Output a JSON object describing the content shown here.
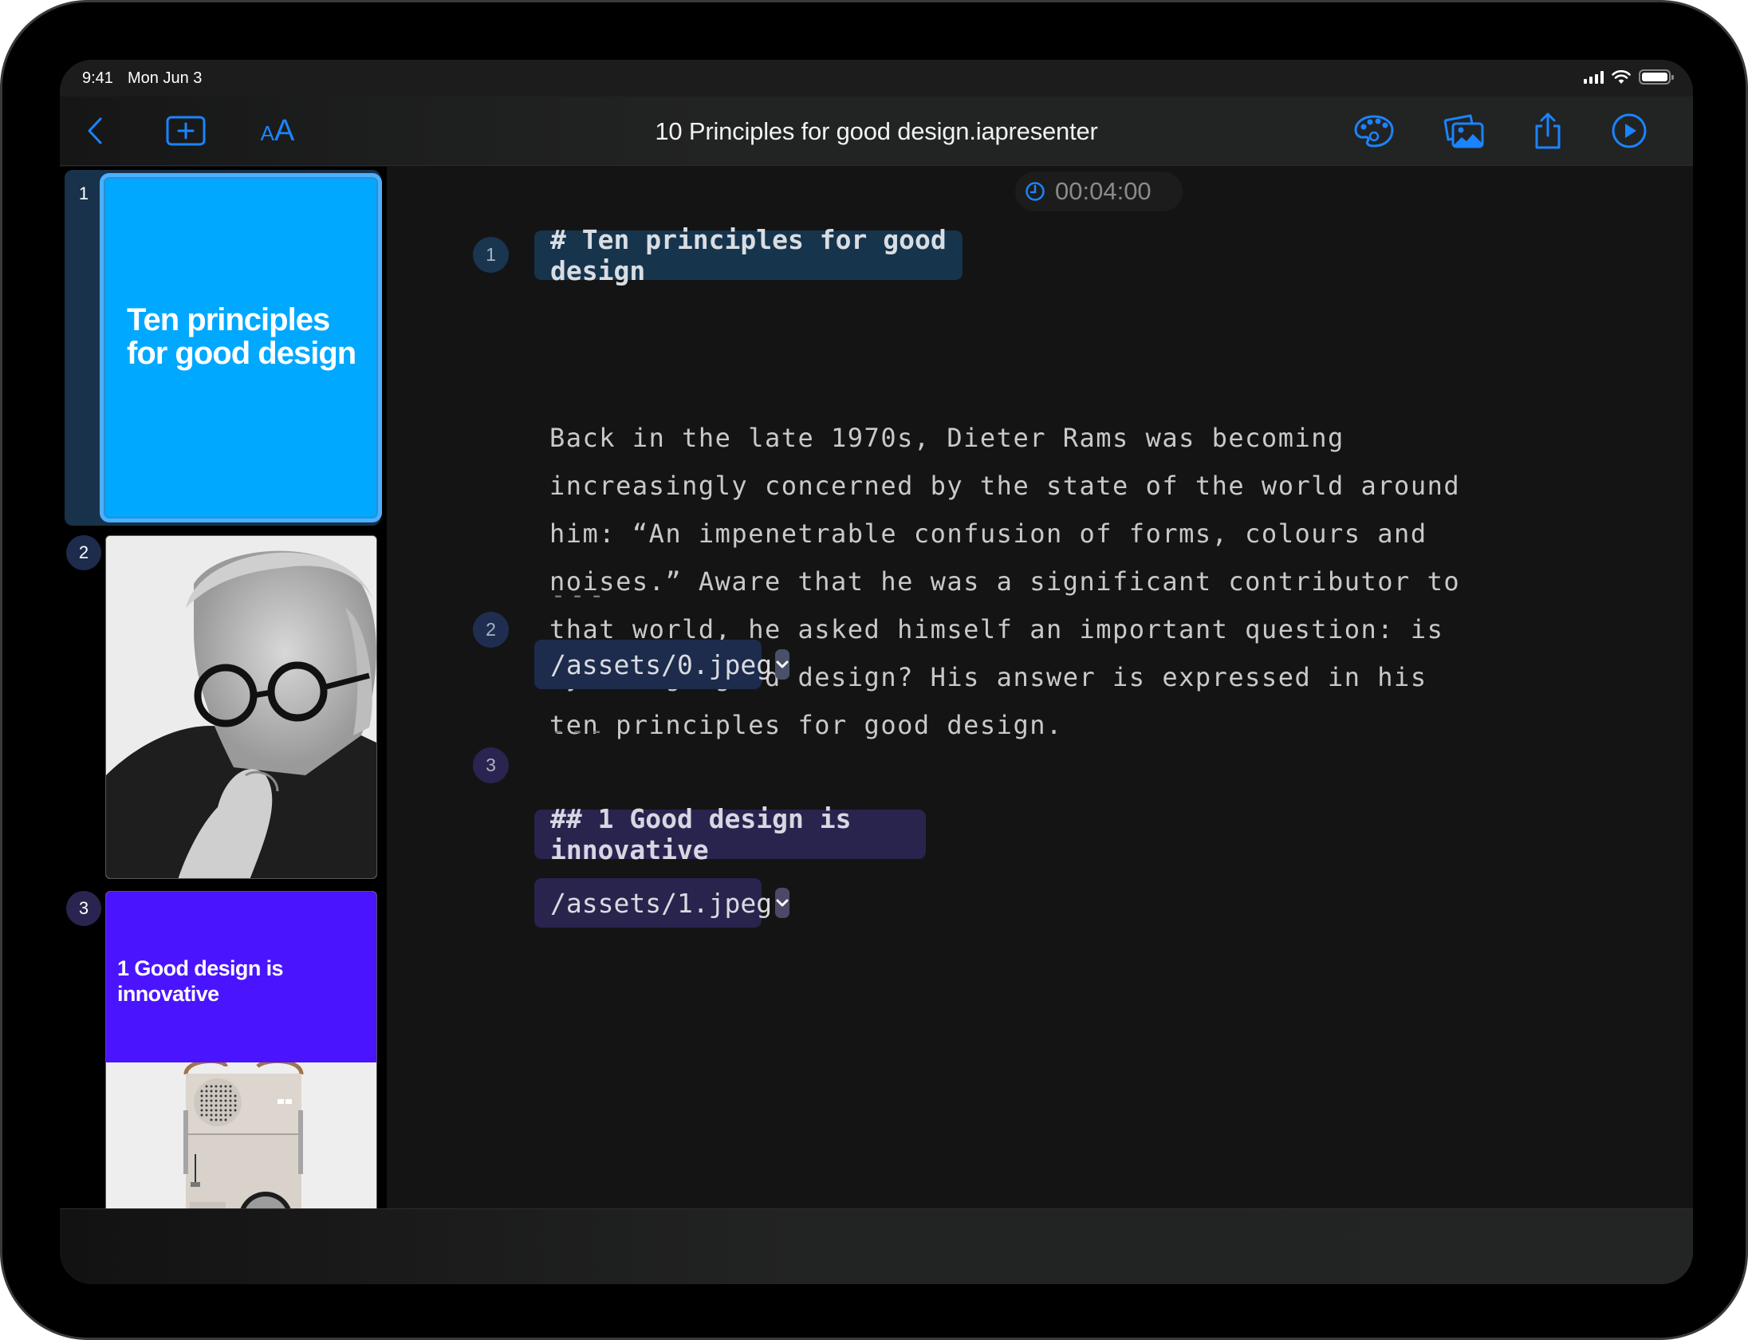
{
  "status_bar": {
    "time": "9:41",
    "date": "Mon Jun 3",
    "icons": [
      "cellular-signal-icon",
      "wifi-icon",
      "battery-icon"
    ]
  },
  "toolbar": {
    "left_buttons": [
      {
        "name": "back",
        "icon": "chevron-left-icon"
      },
      {
        "name": "add-slide",
        "icon": "plus-square-icon"
      },
      {
        "name": "text-size",
        "icon": "text-format-icon",
        "label": "AA"
      }
    ],
    "title": "10 Principles for good design.iapresenter",
    "right_buttons": [
      {
        "name": "themes",
        "icon": "palette-icon"
      },
      {
        "name": "media",
        "icon": "photos-icon"
      },
      {
        "name": "share",
        "icon": "share-icon"
      },
      {
        "name": "play",
        "icon": "play-circle-icon"
      }
    ],
    "accent_color": "#1a84ff"
  },
  "sidebar": {
    "slides": [
      {
        "number": "1",
        "title": "Ten principles for good design",
        "background": "#00a8ff",
        "selected": true
      },
      {
        "number": "2",
        "image": "black-and-white portrait of a man with round glasses",
        "selected": false
      },
      {
        "number": "3",
        "title": "1 Good design is innovative",
        "background": "#4a14ff",
        "image": "beige portable radio product photo",
        "selected": false
      }
    ]
  },
  "editor": {
    "timer": "00:04:00",
    "blocks": [
      {
        "marker": "1",
        "heading": "# Ten principles for good design"
      },
      {
        "paragraph": "Back in the late 1970s, Dieter Rams was becoming\nincreasingly concerned by the state of the world around\nhim: “An impenetrable confusion of forms, colours and\nnoises.” Aware that he was a significant contributor to\nthat world, he asked himself an important question: is\nmy design good design? His answer is expressed in his\nten principles for good design."
      },
      {
        "separator": "---"
      },
      {
        "marker": "2",
        "asset": "/assets/0.jpeg"
      },
      {
        "separator": "---"
      },
      {
        "marker": "3",
        "heading": "## 1 Good design is innovative",
        "asset": "/assets/1.jpeg"
      }
    ]
  }
}
